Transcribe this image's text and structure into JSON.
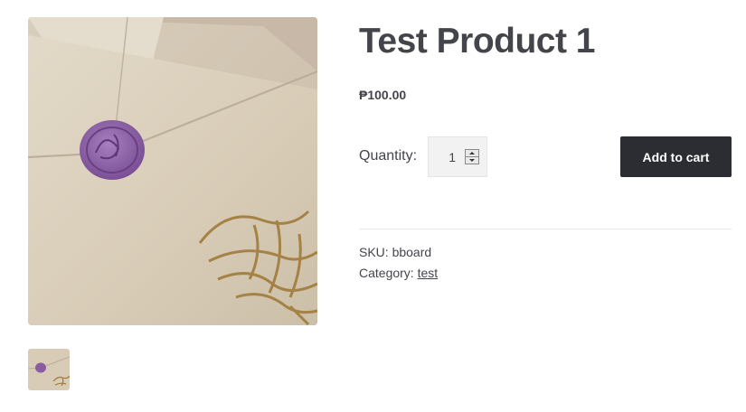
{
  "product": {
    "title": "Test Product 1",
    "price": "₱100.00",
    "quantity_label": "Quantity:",
    "quantity_value": "1",
    "add_to_cart_label": "Add to cart",
    "sku_label": "SKU:",
    "sku_value": "bboard",
    "category_label": "Category:",
    "category_value": "test"
  },
  "gallery": {
    "main_image": "envelope-wax-seal-photo",
    "thumbnail": "envelope-wax-seal-thumbnail"
  },
  "colors": {
    "button_bg": "#2c2d33",
    "text": "#43454b",
    "seal_purple": "#8a5aa3"
  }
}
